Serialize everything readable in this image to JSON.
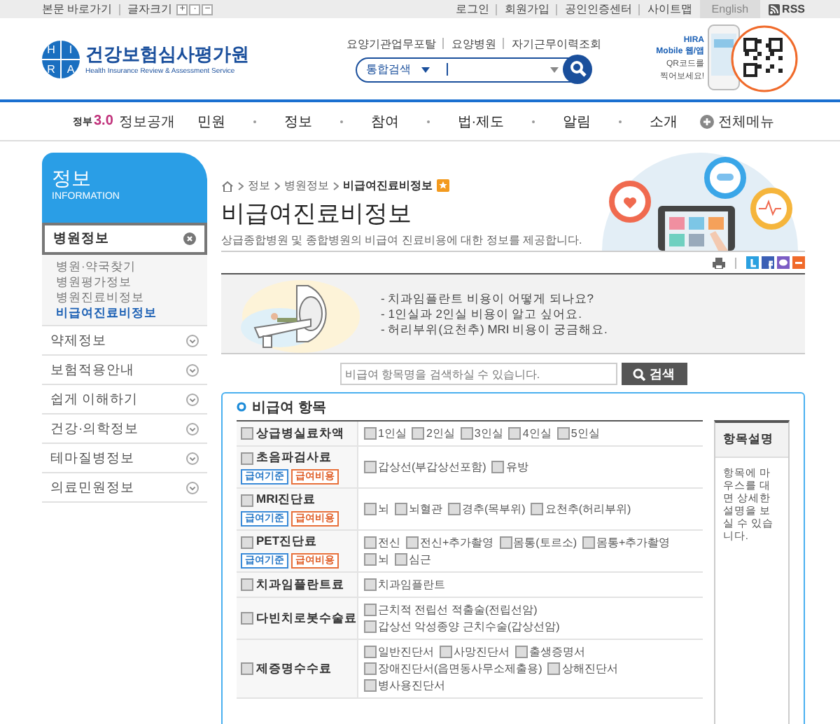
{
  "top_bar": {
    "skip_link": "본문 바로가기",
    "font_size": {
      "label": "글자크기",
      "keys": [
        "+",
        "·",
        "−"
      ]
    },
    "links": [
      "로그인",
      "회원가입",
      "공인인증센터",
      "사이트맵"
    ],
    "language": "English",
    "rss": "RSS"
  },
  "header": {
    "logo": {
      "letters": [
        "H",
        "I",
        "R",
        "A"
      ],
      "name": "건강보험심사평가원",
      "english": "Health Insurance Review & Assessment Service"
    },
    "quick_links": [
      "요양기관업무포탈",
      "요양병원",
      "자기근무이력조회"
    ],
    "search": {
      "scope": "통합검색"
    },
    "mobile": {
      "title": "HIRA",
      "subtitle": "Mobile 웹/앱",
      "hint_lines": [
        "QR코드를",
        "찍어보세요!"
      ]
    }
  },
  "nav": {
    "gov_logo": {
      "text": "정부",
      "version": "3.0"
    },
    "open_info": "정보공개",
    "items": [
      "민원",
      "정보",
      "참여",
      "법·제도",
      "알림",
      "소개"
    ],
    "all_menu": "전체메뉴"
  },
  "sidebar": {
    "title": "정보",
    "subtitle": "INFORMATION",
    "items": [
      {
        "label": "병원정보",
        "selected": true,
        "expanded": true,
        "children": [
          {
            "label": "병원·약국찾기",
            "selected": false
          },
          {
            "label": "병원평가정보",
            "selected": false
          },
          {
            "label": "병원진료비정보",
            "selected": false
          },
          {
            "label": "비급여진료비정보",
            "selected": true
          }
        ]
      },
      {
        "label": "약제정보",
        "selected": false,
        "expanded": false
      },
      {
        "label": "보험적용안내",
        "selected": false,
        "expanded": false
      },
      {
        "label": "쉽게 이해하기",
        "selected": false,
        "expanded": false
      },
      {
        "label": "건강·의학정보",
        "selected": false,
        "expanded": false
      },
      {
        "label": "테마질병정보",
        "selected": false,
        "expanded": false
      },
      {
        "label": "의료민원정보",
        "selected": false,
        "expanded": false
      }
    ]
  },
  "content": {
    "breadcrumb": [
      "정보",
      "병원정보",
      "비급여진료비정보"
    ],
    "title": "비급여진료비정보",
    "description": "상급종합병원 및 종합병원의 비급여 진료비용에 대한 정보를 제공합니다.",
    "questions": [
      "- 치과임플란트 비용이 어떻게 되나요?",
      "- 1인실과 2인실 비용이 알고 싶어요.",
      "- 허리부위(요천추) MRI 비용이 궁금해요."
    ],
    "search": {
      "placeholder": "비급여 항목명을 검색하실 수 있습니다.",
      "button": "검색"
    },
    "section": {
      "heading": "비급여 항목",
      "rows": [
        {
          "label": "상급병실료차액",
          "checked": false,
          "options": [
            {
              "label": "1인실",
              "checked": false
            },
            {
              "label": "2인실",
              "checked": false
            },
            {
              "label": "3인실",
              "checked": false
            },
            {
              "label": "4인실",
              "checked": false
            },
            {
              "label": "5인실",
              "checked": false
            }
          ]
        },
        {
          "label": "초음파검사료",
          "checked": false,
          "buttons": [
            {
              "label": "급여기준",
              "kind": "criteria"
            },
            {
              "label": "급여비용",
              "kind": "cost"
            }
          ],
          "options": [
            {
              "label": "갑상선(부갑상선포함)",
              "checked": false
            },
            {
              "label": "유방",
              "checked": false
            }
          ]
        },
        {
          "label": "MRI진단료",
          "checked": false,
          "buttons": [
            {
              "label": "급여기준",
              "kind": "criteria"
            },
            {
              "label": "급여비용",
              "kind": "cost"
            }
          ],
          "options": [
            {
              "label": "뇌",
              "checked": false
            },
            {
              "label": "뇌혈관",
              "checked": false
            },
            {
              "label": "경추(목부위)",
              "checked": false
            },
            {
              "label": "요천추(허리부위)",
              "checked": false
            }
          ]
        },
        {
          "label": "PET진단료",
          "checked": false,
          "buttons": [
            {
              "label": "급여기준",
              "kind": "criteria"
            },
            {
              "label": "급여비용",
              "kind": "cost"
            }
          ],
          "options": [
            {
              "label": "전신",
              "checked": false
            },
            {
              "label": "전신+추가촬영",
              "checked": false
            },
            {
              "label": "몸통(토르소)",
              "checked": false
            },
            {
              "label": "몸통+추가촬영",
              "checked": false
            },
            {
              "label": "뇌",
              "checked": false
            },
            {
              "label": "심근",
              "checked": false
            }
          ]
        },
        {
          "label": "치과임플란트료",
          "checked": false,
          "options": [
            {
              "label": "치과임플란트",
              "checked": false
            }
          ]
        },
        {
          "label": "다빈치로봇수술료",
          "checked": false,
          "options": [
            {
              "label": "근치적 전립선 적출술(전립선암)",
              "checked": false
            },
            {
              "label": "갑상선 악성종양 근치수술(갑상선암)",
              "checked": false
            }
          ]
        },
        {
          "label": "제증명수수료",
          "checked": false,
          "options": [
            {
              "label": "일반진단서",
              "checked": false
            },
            {
              "label": "사망진단서",
              "checked": false
            },
            {
              "label": "출생증명서",
              "checked": false
            },
            {
              "label": "장애진단서(읍면동사무소제출용)",
              "checked": false
            },
            {
              "label": "상해진단서",
              "checked": false
            },
            {
              "label": "병사용진단서",
              "checked": false
            }
          ]
        }
      ],
      "help": {
        "title": "항목설명",
        "text": "항목에 마우스를 대면 상세한 설명을 보실 수 있습니다."
      }
    }
  }
}
